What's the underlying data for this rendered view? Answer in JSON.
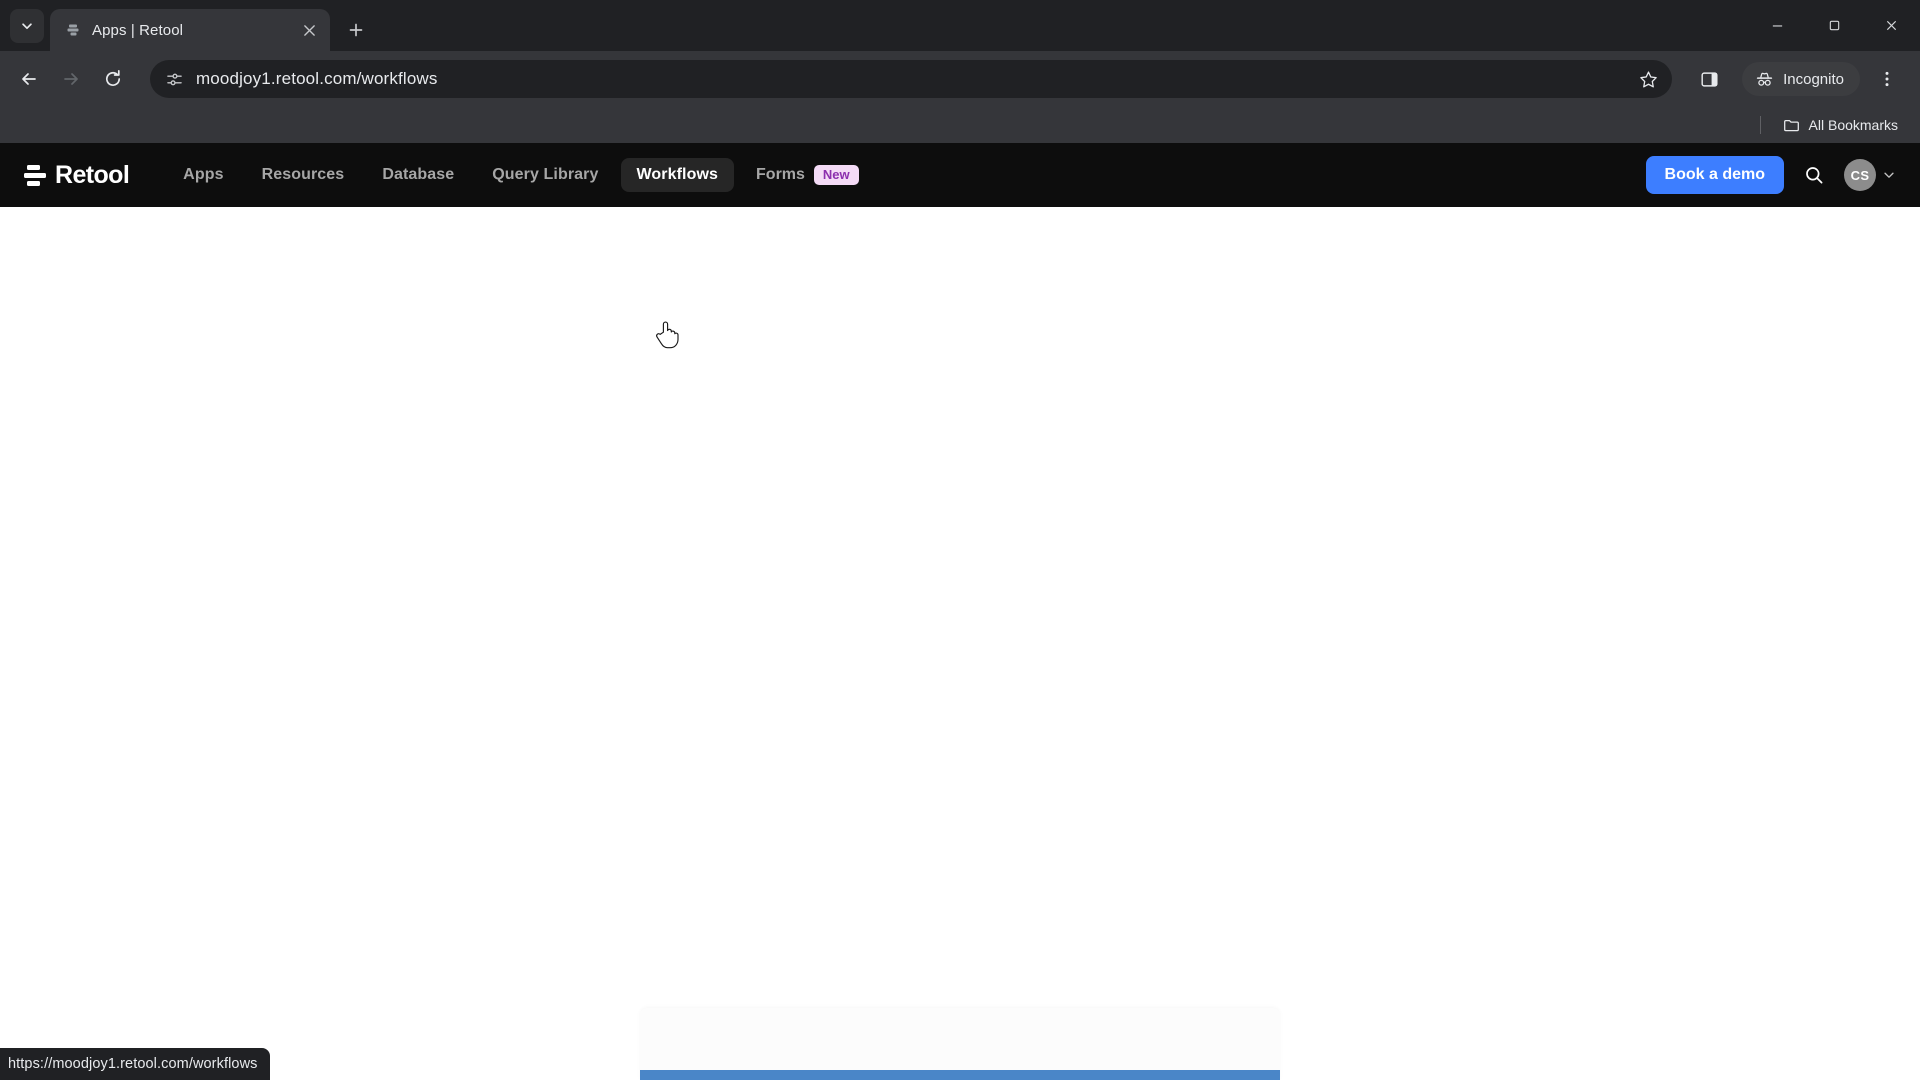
{
  "browser": {
    "tab": {
      "title": "Apps | Retool",
      "favicon_icon": "retool-favicon",
      "close_icon": "close-icon"
    },
    "tab_search_icon": "chevron-down-icon",
    "new_tab_icon": "plus-icon",
    "window_controls": {
      "minimize_icon": "minimize-icon",
      "maximize_icon": "restore-icon",
      "close_icon": "close-icon"
    },
    "toolbar": {
      "back_icon": "arrow-left-icon",
      "forward_icon": "arrow-right-icon",
      "reload_icon": "reload-icon",
      "site_info_icon": "tune-sliders-icon",
      "url": "moodjoy1.retool.com/workflows",
      "url_placeholder": "Search Google or type a URL",
      "bookmark_icon": "star-icon",
      "side_panel_icon": "side-panel-icon",
      "incognito_label": "Incognito",
      "incognito_icon": "incognito-hat-icon",
      "menu_icon": "three-dot-menu-icon"
    },
    "bookmarks": {
      "all_bookmarks_label": "All Bookmarks",
      "folder_icon": "folder-icon"
    },
    "status_bubble": "https://moodjoy1.retool.com/workflows"
  },
  "retool": {
    "logo": {
      "wordmark": "Retool",
      "mark_icon": "retool-logo-icon"
    },
    "nav_items": [
      {
        "label": "Apps",
        "active": false
      },
      {
        "label": "Resources",
        "active": false
      },
      {
        "label": "Database",
        "active": false
      },
      {
        "label": "Query Library",
        "active": false
      },
      {
        "label": "Workflows",
        "active": true
      }
    ],
    "forms_item": {
      "label": "Forms",
      "badge": "New"
    },
    "actions": {
      "book_demo_label": "Book a demo",
      "search_icon": "search-icon",
      "avatar_initials": "CS",
      "chevron_icon": "chevron-down-icon"
    },
    "colors": {
      "navbar_bg": "#0d0d0d",
      "accent_blue": "#3d7eff",
      "badge_bg": "#f4dbf6",
      "badge_text": "#8c2fae",
      "active_pill_bg": "#262626",
      "loading_bar": "#4a86c8"
    }
  },
  "page": {
    "state": "loading",
    "body_text": ""
  }
}
